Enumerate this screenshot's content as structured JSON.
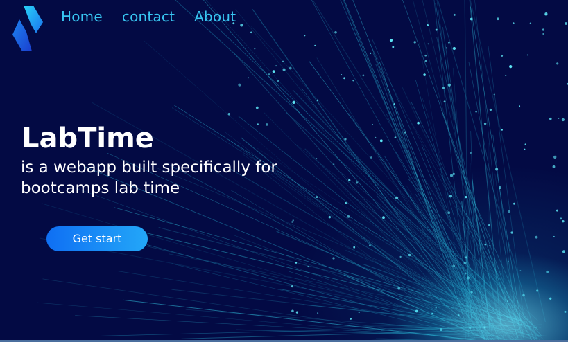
{
  "brand": {
    "logo_icon": "chevron-diamond-logo-icon",
    "colors": {
      "background": "#030a44",
      "nav_link": "#38c6f2",
      "accent_start": "#0f6ff3",
      "accent_end": "#23a7f8",
      "particle": "#5fe6f6"
    }
  },
  "nav": {
    "items": [
      {
        "label": "Home"
      },
      {
        "label": "contact"
      },
      {
        "label": "About"
      }
    ]
  },
  "hero": {
    "title": "LabTime",
    "subtitle": "is a webapp built specifically for bootcamps lab time",
    "cta_label": "Get start"
  }
}
